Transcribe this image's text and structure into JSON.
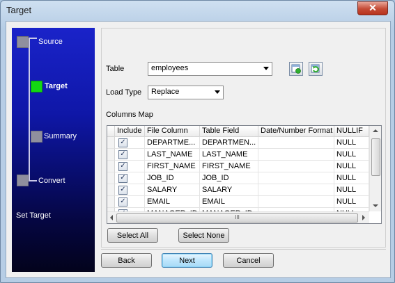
{
  "window": {
    "title": "Target",
    "close_glyph": "✕"
  },
  "sidebar": {
    "steps": [
      {
        "label": "Source",
        "active": false
      },
      {
        "label": "Target",
        "active": true
      },
      {
        "label": "Summary",
        "active": false
      },
      {
        "label": "Convert",
        "active": false
      }
    ],
    "caption": "Set Target"
  },
  "form": {
    "table_label": "Table",
    "table_value": "employees",
    "load_type_label": "Load Type",
    "load_type_value": "Replace",
    "columns_map_label": "Columns Map"
  },
  "grid": {
    "headers": [
      "Include",
      "File Column",
      "Table Field",
      "Date/Number Format",
      "NULLIF"
    ],
    "rows": [
      {
        "include": true,
        "file_column": "DEPARTME...",
        "table_field": "DEPARTMEN...",
        "format": "",
        "nullif": "NULL"
      },
      {
        "include": true,
        "file_column": "LAST_NAME",
        "table_field": "LAST_NAME",
        "format": "",
        "nullif": "NULL"
      },
      {
        "include": true,
        "file_column": "FIRST_NAME",
        "table_field": "FIRST_NAME",
        "format": "",
        "nullif": "NULL"
      },
      {
        "include": true,
        "file_column": "JOB_ID",
        "table_field": "JOB_ID",
        "format": "",
        "nullif": "NULL"
      },
      {
        "include": true,
        "file_column": "SALARY",
        "table_field": "SALARY",
        "format": "",
        "nullif": "NULL"
      },
      {
        "include": true,
        "file_column": "EMAIL",
        "table_field": "EMAIL",
        "format": "",
        "nullif": "NULL"
      },
      {
        "include": true,
        "file_column": "MANAGER_ID",
        "table_field": "MANAGER_ID",
        "format": "",
        "nullif": "NULL"
      }
    ],
    "hscroll_grip": "III"
  },
  "buttons": {
    "select_all": "Select All",
    "select_none": "Select None",
    "back": "Back",
    "next": "Next",
    "cancel": "Cancel"
  },
  "colors": {
    "sidebar_top": "#1a23c9",
    "active_step": "#13d813",
    "inactive_step": "#8f8f9e"
  }
}
